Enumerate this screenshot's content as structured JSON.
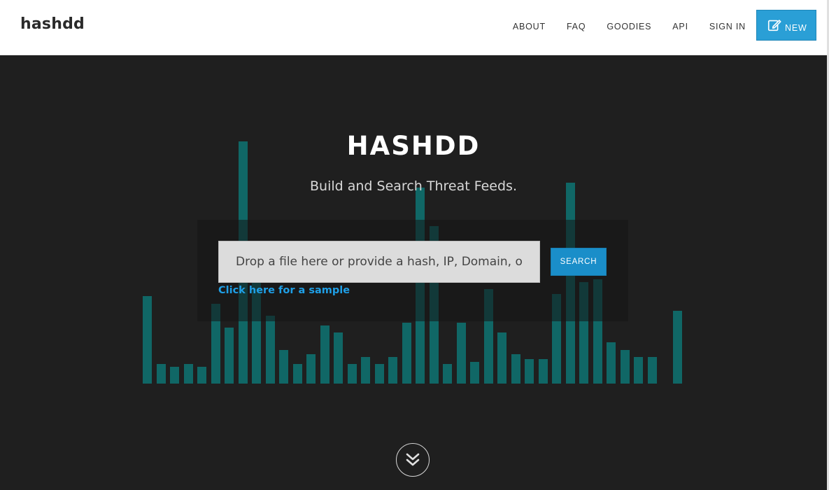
{
  "navbar": {
    "brand": "hashdd",
    "links": [
      "ABOUT",
      "FAQ",
      "GOODIES",
      "API",
      "SIGN IN"
    ],
    "new_button": {
      "label": "NEW",
      "icon": "edit-icon"
    }
  },
  "hero": {
    "title": "HASHDD",
    "subtitle": "Build and Search Threat Feeds.",
    "search": {
      "placeholder": "Drop a file here or provide a hash, IP, Domain, or URL",
      "button_label": "SEARCH",
      "sample_link": "Click here for a sample"
    },
    "scroll_icon": "double-chevron-down-icon",
    "background_bars": [
      0.36,
      0.08,
      0.07,
      0.08,
      0.07,
      0.33,
      0.23,
      1.0,
      0.46,
      0.28,
      0.14,
      0.08,
      0.12,
      0.24,
      0.21,
      0.08,
      0.11,
      0.08,
      0.11,
      0.25,
      0.81,
      0.65,
      0.08,
      0.25,
      0.09,
      0.39,
      0.21,
      0.12,
      0.1,
      0.1,
      0.37,
      0.83,
      0.42,
      0.43,
      0.17,
      0.14,
      0.11,
      0.11,
      0.3
    ],
    "accent_colors": {
      "bar": "#0f6e6c",
      "button": "#2a9fd6",
      "link": "#1f9fe6",
      "hero_background": "#1f1f1f"
    }
  }
}
